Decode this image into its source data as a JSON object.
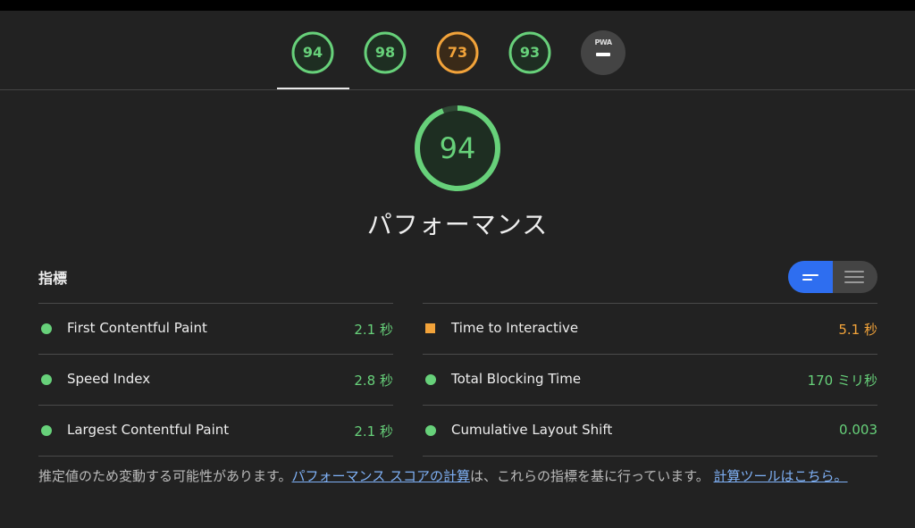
{
  "colors": {
    "pass": "#67d17a",
    "average": "#f2a33a",
    "accent": "#2e6ef0",
    "link": "#7fb1f6"
  },
  "gauges": [
    {
      "value": "94",
      "score": 0.94,
      "status": "pass"
    },
    {
      "value": "98",
      "score": 0.98,
      "status": "pass"
    },
    {
      "value": "73",
      "score": 0.73,
      "status": "average"
    },
    {
      "value": "93",
      "score": 0.93,
      "status": "pass"
    }
  ],
  "pwa": {
    "label": "PWA",
    "icon": "dash-icon"
  },
  "main_gauge": {
    "value": "94",
    "score": 0.94,
    "title": "パフォーマンス"
  },
  "metrics": {
    "heading": "指標",
    "view_toggle": {
      "icons": [
        "compact-view-icon",
        "expanded-view-icon"
      ],
      "selected": "compact-view-icon"
    },
    "left": [
      {
        "name": "First Contentful Paint",
        "value": "2.1 秒",
        "status": "pass",
        "marker": "circle"
      },
      {
        "name": "Speed Index",
        "value": "2.8 秒",
        "status": "pass",
        "marker": "circle"
      },
      {
        "name": "Largest Contentful Paint",
        "value": "2.1 秒",
        "status": "pass",
        "marker": "circle"
      }
    ],
    "right": [
      {
        "name": "Time to Interactive",
        "value": "5.1 秒",
        "status": "average",
        "marker": "square"
      },
      {
        "name": "Total Blocking Time",
        "value": "170 ミリ秒",
        "status": "pass",
        "marker": "circle"
      },
      {
        "name": "Cumulative Layout Shift",
        "value": "0.003",
        "status": "pass",
        "marker": "circle"
      }
    ]
  },
  "footnote": {
    "text1": "推定値のため変動する可能性があります。",
    "link1": "パフォーマンス スコアの計算",
    "text2": "は、これらの指標を基に行っています。",
    "link2": "計算ツールはこちら。"
  }
}
